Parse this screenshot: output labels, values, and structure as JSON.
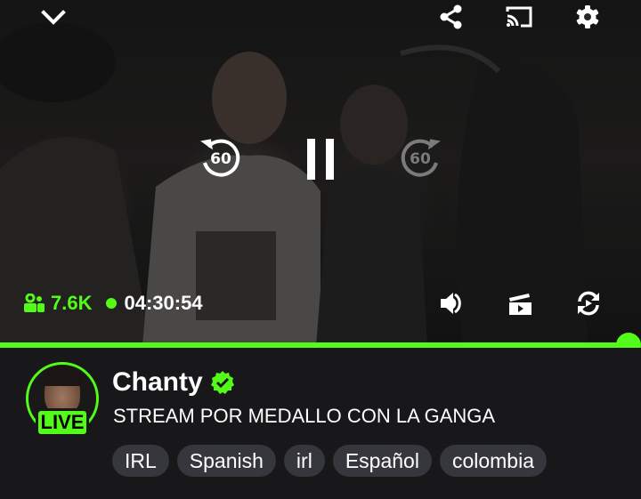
{
  "icons": {
    "collapse": "chevron-down-icon",
    "share": "share-icon",
    "cast": "cast-icon",
    "settings": "gear-icon",
    "rewind": "rewind-icon",
    "pause": "pause-icon",
    "forward": "fast-forward-icon",
    "viewers": "viewers-icon",
    "volume": "volume-icon",
    "theater": "theater-mode-icon",
    "autoplay": "autoplay-icon",
    "verified": "verified-badge-icon"
  },
  "colors": {
    "accent": "#53fc18",
    "background": "#18181b",
    "tag_background": "#36363d",
    "disabled_control": "#7b7b7b"
  },
  "controls": {
    "rewind_seconds": "60",
    "forward_seconds": "60"
  },
  "stats": {
    "viewers": "7.6K",
    "uptime": "04:30:54"
  },
  "progress": {
    "fraction": 0.98
  },
  "channel": {
    "name": "Chanty",
    "live_badge": "LIVE",
    "stream_title": "STREAM POR MEDALLO CON LA GANGA"
  },
  "tags": [
    "IRL",
    "Spanish",
    "irl",
    "Español",
    "colombia"
  ]
}
